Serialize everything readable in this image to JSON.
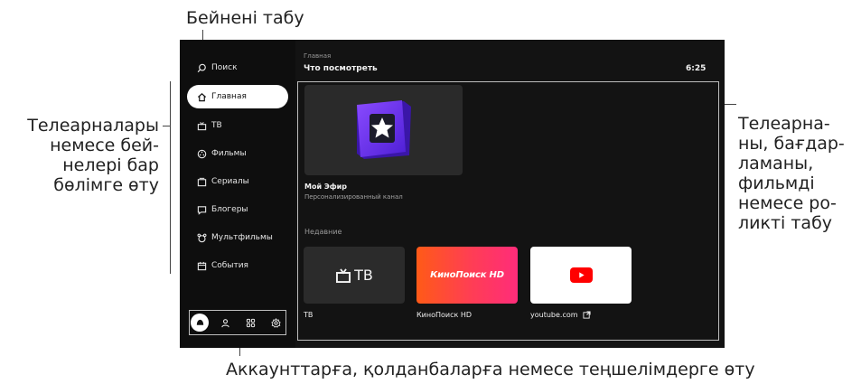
{
  "callouts": {
    "search": "Бейнені табу",
    "sections": "Телеарналары\nнемесе бей-\nнелері бар\nбөлімге өту",
    "content": "Телеарна-\nны, бағдар-\nламаны,\nфильмді\nнемесе ро-\nликті табу",
    "bottom": "Аккаунттарға, қолданбаларға немесе теңшелімдерге өту"
  },
  "sidebar": {
    "items": [
      {
        "label": "Поиск",
        "icon": "search-icon"
      },
      {
        "label": "Главная",
        "icon": "home-icon",
        "active": true
      },
      {
        "label": "ТВ",
        "icon": "tv-icon"
      },
      {
        "label": "Фильмы",
        "icon": "film-icon"
      },
      {
        "label": "Сериалы",
        "icon": "series-icon"
      },
      {
        "label": "Блогеры",
        "icon": "blogger-icon"
      },
      {
        "label": "Мультфильмы",
        "icon": "cartoon-icon"
      },
      {
        "label": "События",
        "icon": "calendar-icon"
      }
    ],
    "bottom_icons": [
      "alice-icon",
      "user-icon",
      "apps-grid-icon",
      "settings-gear-icon"
    ]
  },
  "header": {
    "breadcrumb": "Главная",
    "title": "Что посмотреть",
    "clock": "6:25"
  },
  "hero": {
    "title": "Мой Эфир",
    "subtitle": "Персонализированный канал",
    "icon": "star-cube-icon"
  },
  "recent": {
    "title": "Недавние",
    "items": [
      {
        "label": "ТВ",
        "logo_text": "ТВ",
        "icon": "tv-icon"
      },
      {
        "label": "КиноПоиск HD",
        "logo_text": "КиноПоиск HD",
        "icon": "kinopoisk-logo"
      },
      {
        "label": "youtube.com",
        "icon": "youtube-logo",
        "external": "external-link-icon"
      }
    ]
  },
  "colors": {
    "screen_bg": "#131313",
    "active_item": "#ffffff",
    "kinopoisk_gradient": [
      "#ff5a17",
      "#ff2c7a"
    ],
    "hero_accent": "#6b2bff"
  }
}
